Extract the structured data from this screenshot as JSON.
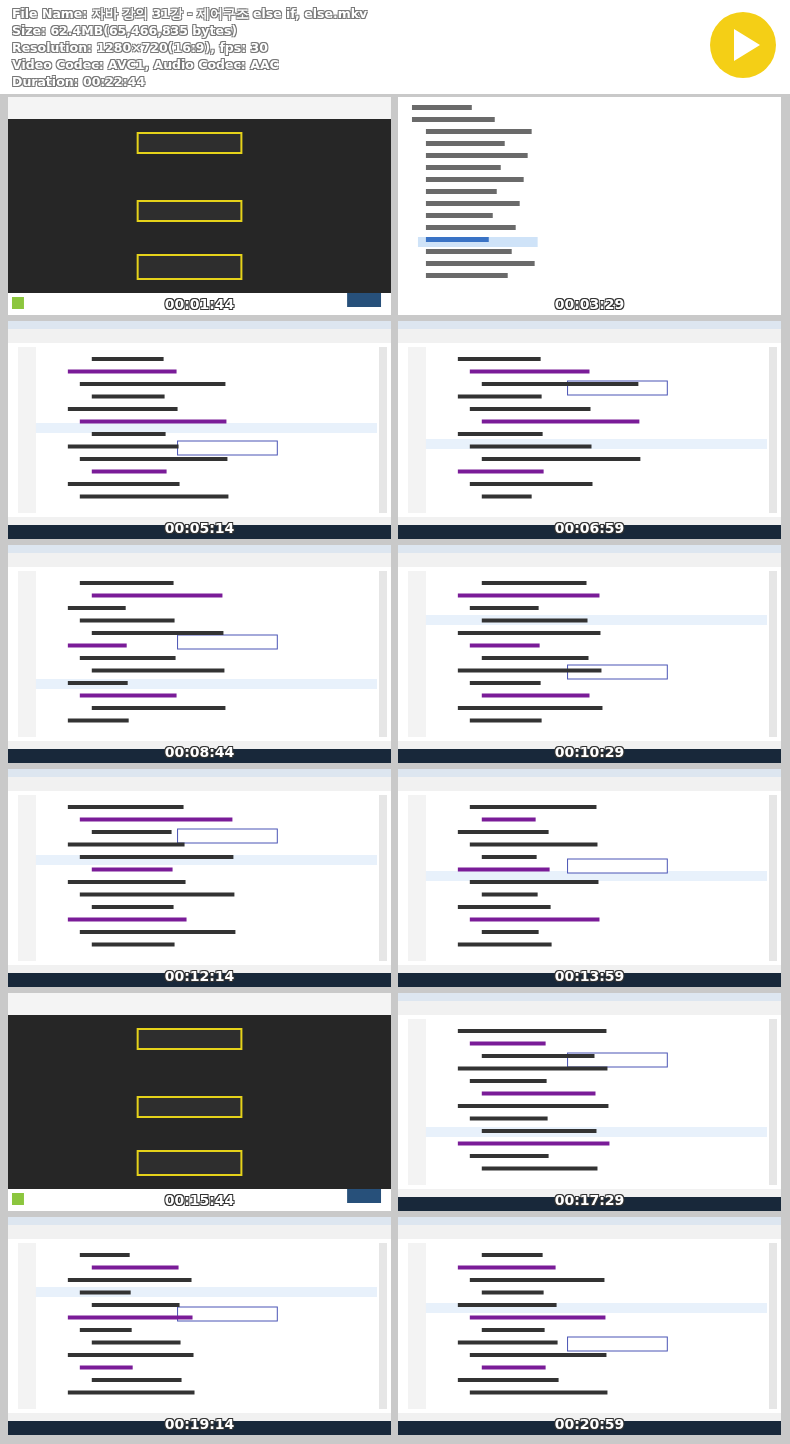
{
  "header": {
    "lines": [
      "File Name: 자바 강의 31강 - 제어구조 else if, else.mkv",
      "Size: 62.4MB(65,466,835 bytes)",
      "Resolution: 1280×720(16:9), fps: 30",
      "Video Codec: AVC1, Audio Codec: AAC",
      "Duration: 00:22:44"
    ]
  },
  "thumbnails": [
    {
      "kind": "picture",
      "timestamp": "00:01:44"
    },
    {
      "kind": "picture",
      "timestamp": "00:03:29"
    },
    {
      "kind": "picture",
      "timestamp": "00:05:14"
    },
    {
      "kind": "picture",
      "timestamp": "00:06:59"
    },
    {
      "kind": "picture",
      "timestamp": "00:08:44"
    },
    {
      "kind": "picture",
      "timestamp": "00:10:29"
    },
    {
      "kind": "picture",
      "timestamp": "00:12:14"
    },
    {
      "kind": "picture",
      "timestamp": "00:13:59"
    },
    {
      "kind": "picture",
      "timestamp": "00:15:44"
    },
    {
      "kind": "picture",
      "timestamp": "00:17:29"
    },
    {
      "kind": "picture",
      "timestamp": "00:19:14"
    },
    {
      "kind": "picture",
      "timestamp": "00:20:59"
    }
  ]
}
